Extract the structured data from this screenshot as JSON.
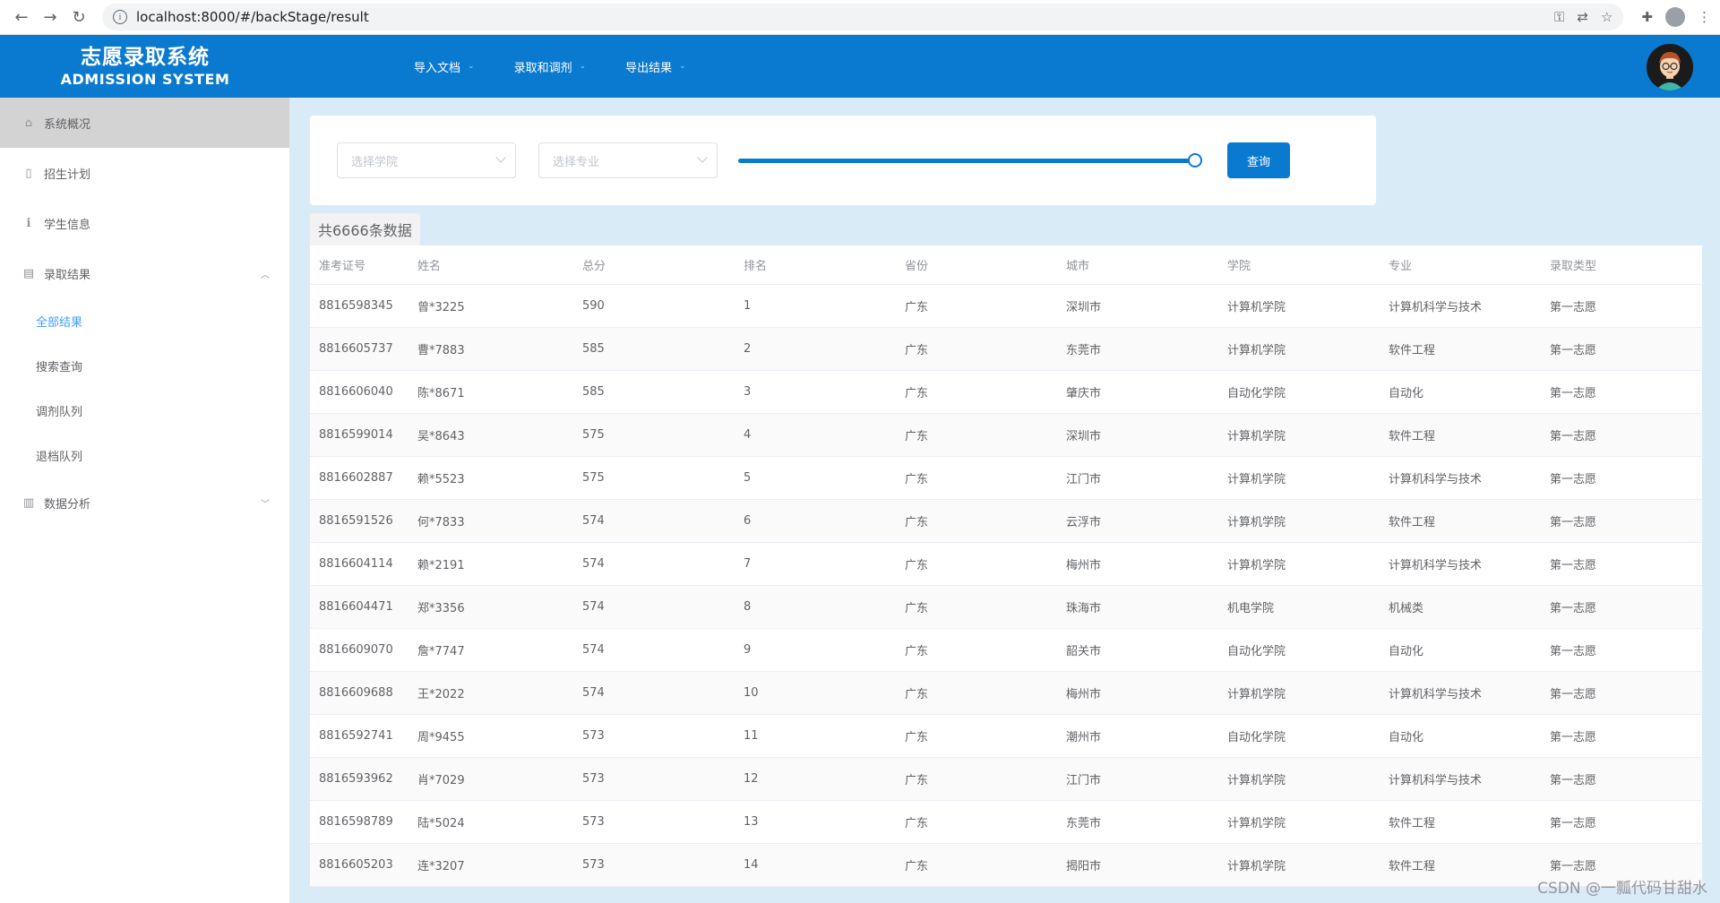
{
  "browser": {
    "url": "localhost:8000/#/backStage/result",
    "back_glyph": "←",
    "forward_glyph": "→",
    "reload_glyph": "↻",
    "info_glyph": "i",
    "key_glyph": "⚿",
    "translate_glyph": "⇄",
    "star_glyph": "☆",
    "ext_glyph": "✚",
    "menu_glyph": "⋮"
  },
  "header": {
    "title_cn": "志愿录取系统",
    "title_en": "ADMISSION SYSTEM",
    "menu": [
      {
        "label": "导入文档"
      },
      {
        "label": "录取和调剂"
      },
      {
        "label": "导出结果"
      }
    ],
    "caret": "⌄",
    "bg_color": "#0a7ad0"
  },
  "sidebar": {
    "items": [
      {
        "label": "系统概况",
        "icon": "home-icon",
        "glyph": "⌂"
      },
      {
        "label": "招生计划",
        "icon": "book-icon",
        "glyph": "▯"
      },
      {
        "label": "学生信息",
        "icon": "info-icon",
        "glyph": "ℹ"
      },
      {
        "label": "录取结果",
        "icon": "document-icon",
        "glyph": "▤",
        "arrow": "︿"
      },
      {
        "label": "数据分析",
        "icon": "bar-chart-icon",
        "glyph": "▥",
        "arrow": "﹀"
      }
    ],
    "sub_items": [
      {
        "label": "全部结果"
      },
      {
        "label": "搜索查询"
      },
      {
        "label": "调剂队列"
      },
      {
        "label": "退档队列"
      }
    ]
  },
  "filter": {
    "college_placeholder": "选择学院",
    "major_placeholder": "选择专业",
    "slider_value": 1.0,
    "query_label": "查询"
  },
  "count_label": "共6666条数据",
  "table": {
    "headers": [
      "准考证号",
      "姓名",
      "总分",
      "排名",
      "省份",
      "城市",
      "学院",
      "专业",
      "录取类型"
    ],
    "rows": [
      [
        "8816598345",
        "曾*3225",
        "590",
        "1",
        "广东",
        "深圳市",
        "计算机学院",
        "计算机科学与技术",
        "第一志愿"
      ],
      [
        "8816605737",
        "曹*7883",
        "585",
        "2",
        "广东",
        "东莞市",
        "计算机学院",
        "软件工程",
        "第一志愿"
      ],
      [
        "8816606040",
        "陈*8671",
        "585",
        "3",
        "广东",
        "肇庆市",
        "自动化学院",
        "自动化",
        "第一志愿"
      ],
      [
        "8816599014",
        "吴*8643",
        "575",
        "4",
        "广东",
        "深圳市",
        "计算机学院",
        "软件工程",
        "第一志愿"
      ],
      [
        "8816602887",
        "赖*5523",
        "575",
        "5",
        "广东",
        "江门市",
        "计算机学院",
        "计算机科学与技术",
        "第一志愿"
      ],
      [
        "8816591526",
        "何*7833",
        "574",
        "6",
        "广东",
        "云浮市",
        "计算机学院",
        "软件工程",
        "第一志愿"
      ],
      [
        "8816604114",
        "赖*2191",
        "574",
        "7",
        "广东",
        "梅州市",
        "计算机学院",
        "计算机科学与技术",
        "第一志愿"
      ],
      [
        "8816604471",
        "郑*3356",
        "574",
        "8",
        "广东",
        "珠海市",
        "机电学院",
        "机械类",
        "第一志愿"
      ],
      [
        "8816609070",
        "詹*7747",
        "574",
        "9",
        "广东",
        "韶关市",
        "自动化学院",
        "自动化",
        "第一志愿"
      ],
      [
        "8816609688",
        "王*2022",
        "574",
        "10",
        "广东",
        "梅州市",
        "计算机学院",
        "计算机科学与技术",
        "第一志愿"
      ],
      [
        "8816592741",
        "周*9455",
        "573",
        "11",
        "广东",
        "潮州市",
        "自动化学院",
        "自动化",
        "第一志愿"
      ],
      [
        "8816593962",
        "肖*7029",
        "573",
        "12",
        "广东",
        "江门市",
        "计算机学院",
        "计算机科学与技术",
        "第一志愿"
      ],
      [
        "8816598789",
        "陆*5024",
        "573",
        "13",
        "广东",
        "东莞市",
        "计算机学院",
        "软件工程",
        "第一志愿"
      ],
      [
        "8816605203",
        "连*3207",
        "573",
        "14",
        "广东",
        "揭阳市",
        "计算机学院",
        "软件工程",
        "第一志愿"
      ]
    ]
  },
  "watermark": "CSDN @一瓢代码甘甜水"
}
